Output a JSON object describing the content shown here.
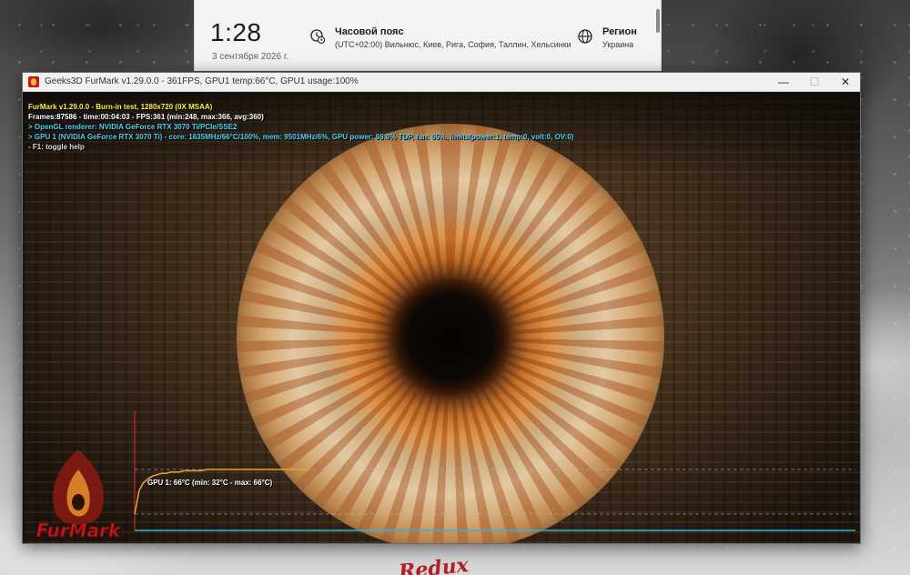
{
  "flyout": {
    "time": "1:28",
    "date": "3 сентября 2026 г.",
    "timezone_title": "Часовой пояс",
    "timezone_value": "(UTC+02:00) Вильнюс, Киев, Рига, София, Таллин, Хельсинки",
    "region_title": "Регион",
    "region_value": "Украина"
  },
  "window": {
    "title": "Geeks3D FurMark v1.29.0.0 - 361FPS, GPU1 temp:66°C, GPU1 usage:100%",
    "minimize_label": "—",
    "maximize_label": "☐",
    "close_label": "✕"
  },
  "osd": {
    "line1": "FurMark v1.29.0.0 - Burn-in test, 1280x720 (0X MSAA)",
    "line2": "Frames:87586 - time:00:04:03 - FPS:361 (min:248, max:366, avg:360)",
    "line3": "> OpenGL renderer: NVIDIA GeForce RTX 3070 Ti/PCIe/SSE2",
    "line4": "> GPU 1 (NVIDIA GeForce RTX 3070 Ti) - core: 1635MHz/66°C/100%, mem: 9501MHz/6%, GPU power: 99.0% TDP, fan: 65%, limits(power:1, temp:0, volt:0, OV:0)",
    "line5": "- F1: toggle help"
  },
  "temp_graph": {
    "label": "GPU 1: 66°C (min: 32°C - max: 66°C)",
    "current": 66,
    "min": 32,
    "max": 66,
    "temperature_color": "#f0a030",
    "baseline_color": "#3ab0d8",
    "axis_color": "#d02020",
    "samples": [
      32,
      50,
      56,
      59,
      61,
      62,
      63,
      63,
      64,
      64,
      64,
      65,
      65,
      65,
      65,
      65,
      66,
      66,
      66,
      66,
      66,
      66,
      66,
      66,
      66,
      66,
      66,
      66,
      66,
      66,
      66,
      66,
      66,
      66,
      66,
      66,
      66,
      66,
      66,
      66
    ]
  },
  "logo": {
    "text": "FurMark"
  },
  "wallpaper": {
    "logo_text": "Redux"
  },
  "colors": {
    "osd_title": "#fff34a",
    "osd_info": "#4fd0f4",
    "brand_red": "#c0161c"
  }
}
